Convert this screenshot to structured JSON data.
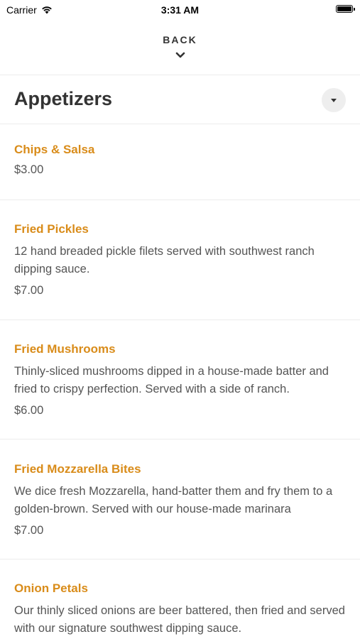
{
  "status": {
    "carrier": "Carrier",
    "time": "3:31 AM"
  },
  "nav": {
    "back_label": "BACK"
  },
  "section": {
    "title": "Appetizers"
  },
  "items": [
    {
      "name": "Chips & Salsa",
      "description": "",
      "price": "$3.00"
    },
    {
      "name": "Fried Pickles",
      "description": "12 hand breaded pickle filets served with southwest ranch dipping sauce.",
      "price": "$7.00"
    },
    {
      "name": "Fried Mushrooms",
      "description": "Thinly-sliced mushrooms dipped in a house-made batter and fried to crispy perfection. Served with a side of ranch.",
      "price": "$6.00"
    },
    {
      "name": "Fried Mozzarella Bites",
      "description": "We dice fresh Mozzarella, hand-batter them and fry them to a golden-brown. Served with our house-made marinara",
      "price": "$7.00"
    },
    {
      "name": "Onion Petals",
      "description": "Our thinly sliced onions are beer battered, then fried and served with our signature southwest dipping sauce.",
      "price": ""
    }
  ],
  "icons": {
    "wifi": "wifi-icon",
    "battery": "battery-icon",
    "chevron": "chevron-down-icon",
    "dropdown": "caret-down-icon"
  },
  "colors": {
    "accent": "#d98c1a",
    "text": "#333333"
  }
}
